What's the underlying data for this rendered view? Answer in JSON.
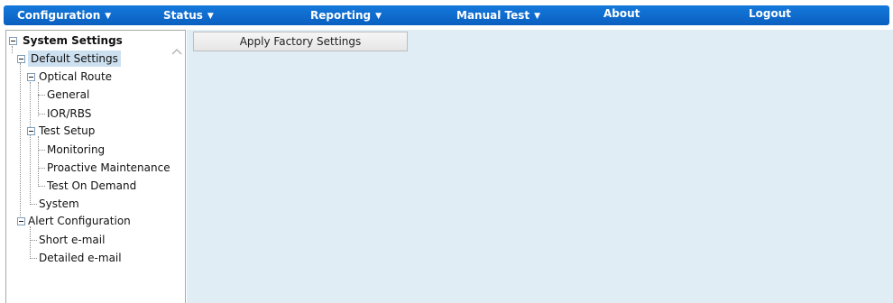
{
  "menu": {
    "configuration": "Configuration",
    "status": "Status",
    "reporting": "Reporting",
    "manual_test": "Manual Test",
    "about": "About",
    "logout": "Logout",
    "caret": "▼"
  },
  "tree": {
    "root": "System Settings",
    "default_settings": "Default Settings",
    "optical_route": "Optical Route",
    "general": "General",
    "ior_rbs": "IOR/RBS",
    "test_setup": "Test Setup",
    "monitoring": "Monitoring",
    "proactive_maintenance": "Proactive Maintenance",
    "test_on_demand": "Test On Demand",
    "system": "System",
    "alert_configuration": "Alert Configuration",
    "short_email": "Short e-mail",
    "detailed_email": "Detailed e-mail"
  },
  "content": {
    "apply_factory_settings": "Apply Factory Settings"
  },
  "colors": {
    "menubar": "#0a6ad0",
    "content_bg": "#e1edf5",
    "selected_bg": "#cde0ef"
  }
}
